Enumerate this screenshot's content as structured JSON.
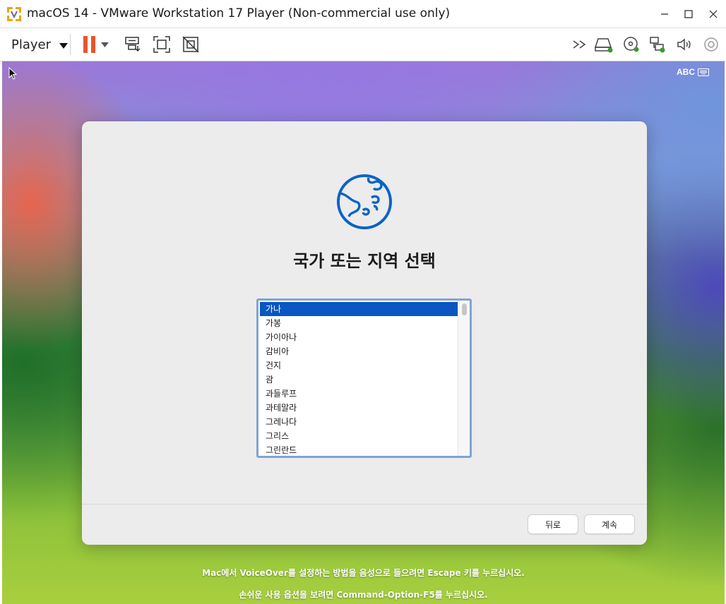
{
  "window": {
    "title": "macOS 14 - VMware Workstation 17 Player (Non-commercial use only)",
    "controls": [
      "minimize",
      "maximize",
      "close"
    ]
  },
  "toolbar": {
    "player_label": "Player",
    "icons": [
      "pause-icon",
      "dropdown-icon",
      "send-ctrl-alt-del-icon",
      "fullscreen-icon",
      "unity-icon",
      "chevrons-icon",
      "hard-disk-icon",
      "cd-dvd-icon",
      "network-adapter-icon",
      "sound-icon",
      "usb-icon"
    ],
    "accent_color": "#e8562a"
  },
  "vm": {
    "input_indicator": "ABC",
    "setup": {
      "heading": "국가 또는 지역 선택",
      "countries": [
        "가나",
        "가봉",
        "가이아나",
        "감비아",
        "건지",
        "괌",
        "과들루프",
        "과테말라",
        "그레나다",
        "그리스",
        "그린란드"
      ],
      "selected_index": 0,
      "back_button": "뒤로",
      "continue_button": "계속"
    },
    "footnote_line1": "Mac에서 VoiceOver를 설정하는 방법을 음성으로 들으려면 Escape 키를 누르십시오.",
    "footnote_line2": "손쉬운 사용 옵션을 보려면 Command-Option-F5를 누르십시오.",
    "selection_color": "#0a56c2",
    "globe_color": "#0a63c8"
  }
}
